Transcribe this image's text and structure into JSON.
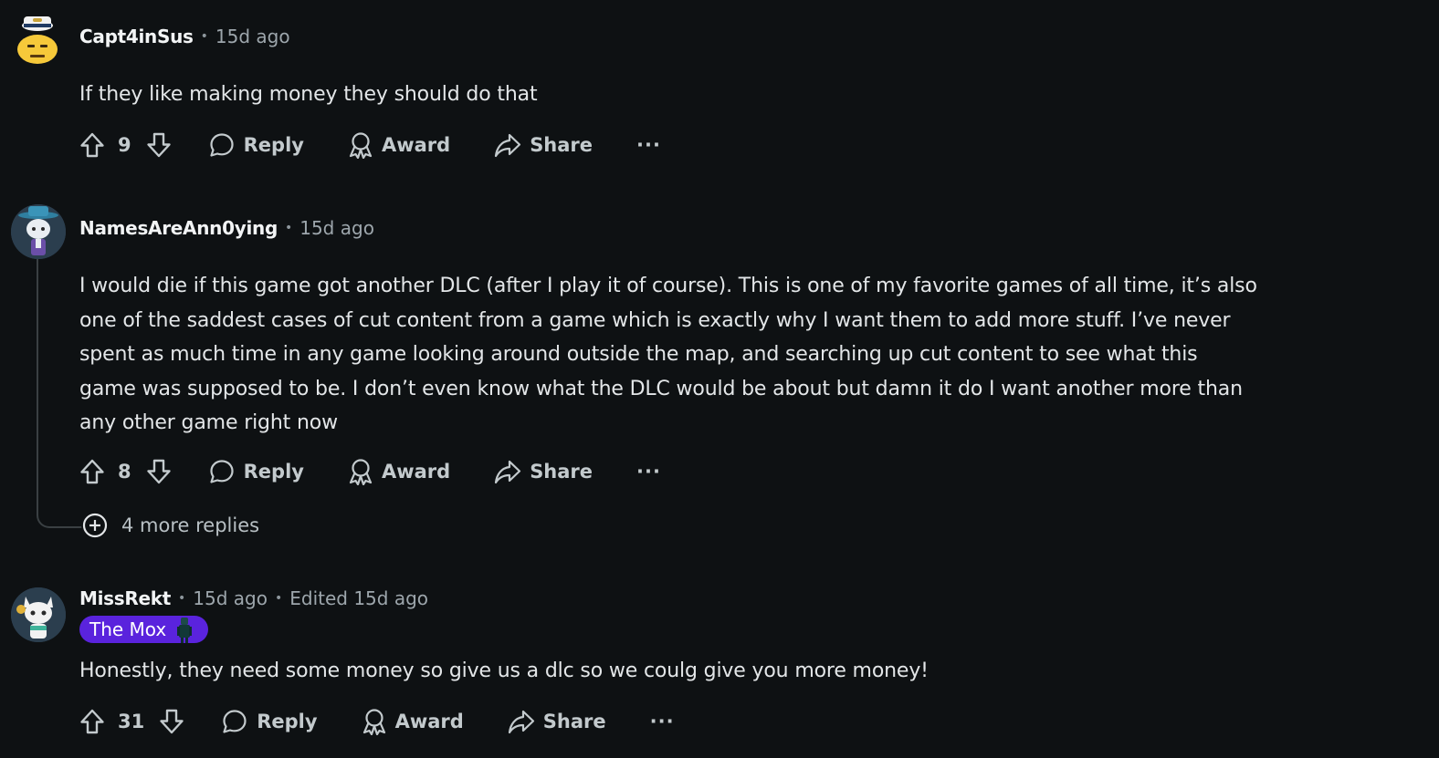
{
  "comments": [
    {
      "author": "Capt4inSus",
      "time": "15d ago",
      "body": "If they like making money they should do that",
      "votes": "9",
      "reply_label": "Reply",
      "award_label": "Award",
      "share_label": "Share",
      "more_label": "···",
      "avatar_icon": "snoo-sailor-avatar-icon"
    },
    {
      "author": "NamesAreAnn0ying",
      "time": "15d ago",
      "body": "I would die if this game got another DLC (after I play it of course). This is one of my favorite games of all time, it’s also one of the saddest cases of cut content from a game which is exactly why I want them to add more stuff. I’ve never spent as much time in any game looking around outside the map, and searching up cut content to see what this game was supposed to be. I don’t even know what the DLC would be about but damn it do I want another more than any other game right now",
      "votes": "8",
      "reply_label": "Reply",
      "award_label": "Award",
      "share_label": "Share",
      "more_label": "···",
      "more_replies": "4 more replies",
      "avatar_icon": "snoo-hat-avatar-icon"
    },
    {
      "author": "MissRekt",
      "time": "15d ago",
      "edited": "Edited 15d ago",
      "flair": "The Mox",
      "body": "Honestly, they need some money so give us a dlc so we coulg give you more money!",
      "votes": "31",
      "reply_label": "Reply",
      "award_label": "Award",
      "share_label": "Share",
      "more_label": "···",
      "avatar_icon": "snoo-cat-avatar-icon"
    }
  ],
  "colors": {
    "background": "#0e1113",
    "flair": "#5a23dd",
    "text": "#e3e6e8",
    "meta": "#9da6ac"
  }
}
